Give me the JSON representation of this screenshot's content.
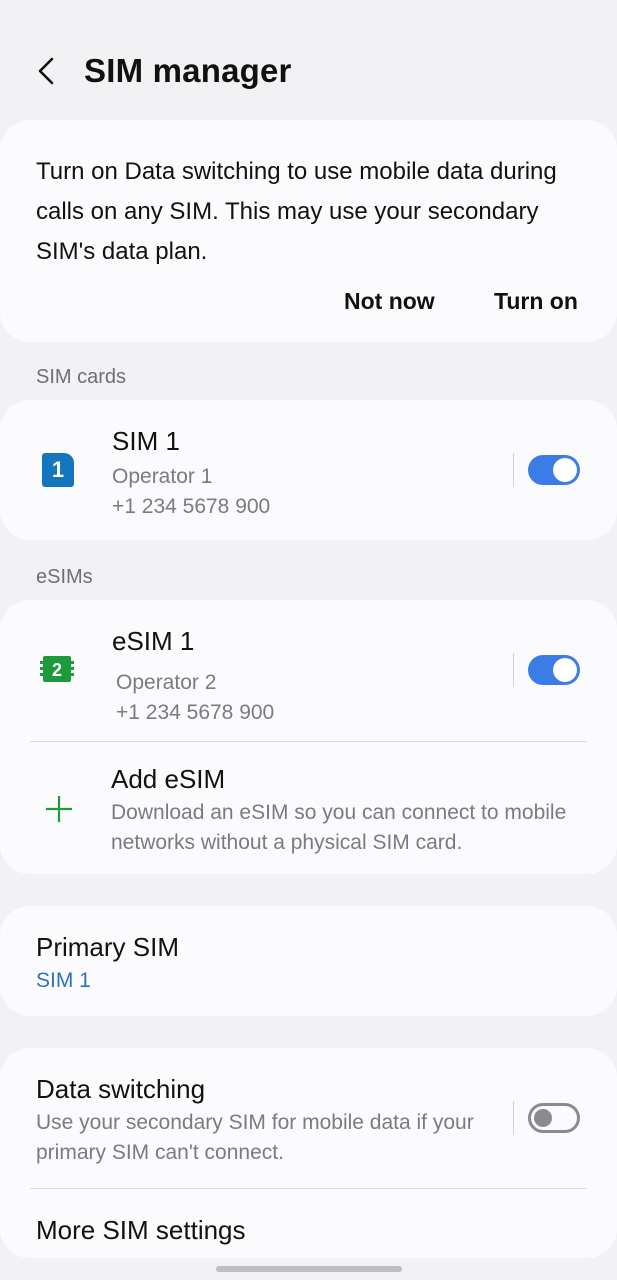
{
  "header": {
    "title": "SIM manager"
  },
  "banner": {
    "text": "Turn on Data switching to use mobile data during calls on any SIM. This may use your secondary SIM's data plan.",
    "not_now": "Not now",
    "turn_on": "Turn on"
  },
  "sections": {
    "sim_cards": "SIM cards",
    "esims": "eSIMs"
  },
  "sim1": {
    "badge": "1",
    "name": "SIM 1",
    "operator": "Operator 1",
    "number": "+1 234 5678 900",
    "enabled": true
  },
  "esim1": {
    "badge": "2",
    "name": "eSIM 1",
    "operator": "Operator 2",
    "number": "+1 234 5678 900",
    "enabled": true
  },
  "add_esim": {
    "title": "Add eSIM",
    "description": "Download an eSIM so you can connect to mobile networks without a physical SIM card."
  },
  "primary_sim": {
    "title": "Primary SIM",
    "value": "SIM 1"
  },
  "data_switching": {
    "title": "Data switching",
    "description": "Use your secondary SIM for mobile data if your primary SIM can't connect.",
    "enabled": false
  },
  "more_settings": {
    "title": "More SIM settings"
  },
  "colors": {
    "accent": "#3b7ce6",
    "sim1_icon": "#1476bd",
    "esim_icon": "#1e9a3a",
    "link": "#2f6fc4"
  }
}
